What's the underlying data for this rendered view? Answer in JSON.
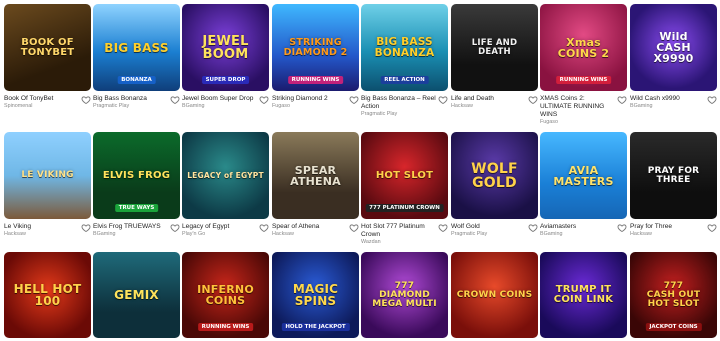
{
  "games": [
    {
      "title": "Book Of TonyBet",
      "provider": "Spinomenal",
      "art": "BOOK OF\nTONYBET",
      "art_color": "#ffd76a",
      "bg": "linear-gradient(160deg,#6b4a1e,#2b1b08 70%)",
      "art_size": "10px",
      "favorite_icon": "heart-outline-icon"
    },
    {
      "title": "Big Bass Bonanza",
      "provider": "Pragmatic Play",
      "art": "BIG BASS",
      "badge": "BONANZA",
      "art_color": "#ffcf2a",
      "badge_bg": "#1560c7",
      "bg": "linear-gradient(180deg,#8fd3ff,#1b7fd1 55%,#0f3e7a)",
      "art_size": "12px",
      "favorite_icon": "heart-outline-icon"
    },
    {
      "title": "Jewel Boom Super Drop",
      "provider": "BGaming",
      "art": "JEWEL\nBOOM",
      "badge": "SUPER DROP",
      "art_color": "#ffe35c",
      "badge_bg": "#2a2ab8",
      "bg": "radial-gradient(circle at 50% 40%,#7b3fd9,#2a0f63 75%)",
      "art_size": "13px",
      "favorite_icon": "heart-outline-icon"
    },
    {
      "title": "Striking Diamond 2",
      "provider": "Fugaso",
      "art": "STRIKING\nDIAMOND 2",
      "badge": "RUNNING WINS",
      "art_color": "#ff9a1a",
      "badge_bg": "#c2227a",
      "bg": "linear-gradient(180deg,#3fb8ff,#2357c9 60%,#1b1b6e)",
      "art_size": "9.5px",
      "favorite_icon": "heart-outline-icon"
    },
    {
      "title": "Big Bass Bonanza – Reel Action",
      "provider": "Pragmatic Play",
      "art": "BIG BASS\nBONANZA",
      "badge": "REEL ACTION",
      "art_color": "#ffcf2a",
      "badge_bg": "#1b3f9c",
      "bg": "linear-gradient(180deg,#6fd0e8,#1a8fb3 55%,#0c4f6e)",
      "art_size": "10.5px",
      "favorite_icon": "heart-outline-icon"
    },
    {
      "title": "Life and Death",
      "provider": "Hacksaw",
      "art": "LIFE AND DEATH",
      "art_color": "#f2f2f2",
      "bg": "linear-gradient(180deg,#3a3a3a,#111 70%)",
      "art_size": "8.5px",
      "favorite_icon": "heart-outline-icon"
    },
    {
      "title": "XMAS Coins 2: ULTIMATE RUNNING WINS",
      "provider": "Fugaso",
      "art": "Xmas\nCOINS 2",
      "badge": "RUNNING WINS",
      "art_color": "#ffd84a",
      "badge_bg": "#d21f3c",
      "bg": "radial-gradient(circle at 50% 35%,#e24a84,#8a1240 75%)",
      "art_size": "11px",
      "favorite_icon": "heart-outline-icon"
    },
    {
      "title": "Wild Cash x9990",
      "provider": "BGaming",
      "art": "Wild\nCASH\nX9990",
      "art_color": "#ffffff",
      "bg": "radial-gradient(circle at 50% 45%,#8a4bf0,#2b1575 70%)",
      "art_size": "11px",
      "favorite_icon": "heart-outline-icon"
    },
    {
      "title": "Le Viking",
      "provider": "Hacksaw",
      "art": "LE VIKING",
      "art_color": "#ffe28a",
      "bg": "linear-gradient(180deg,#8fd0ff,#6fb7e6 50%,#7c5a3a)",
      "art_size": "9px",
      "favorite_icon": "heart-outline-icon"
    },
    {
      "title": "Elvis Frog TRUEWAYS",
      "provider": "BGaming",
      "art": "ELVIS FROG",
      "badge": "TRUE WAYS",
      "art_color": "#ffe35c",
      "badge_bg": "#1aa33a",
      "bg": "linear-gradient(180deg,#0b6b2b,#0a3b1a 70%)",
      "art_size": "10px",
      "favorite_icon": "heart-outline-icon"
    },
    {
      "title": "Legacy of Egypt",
      "provider": "Play'n Go",
      "art": "LEGACY of EGYPT",
      "art_color": "#ffe4a0",
      "bg": "radial-gradient(circle at 50% 40%,#2a8a8a,#0d3a46 75%)",
      "art_size": "7.5px",
      "favorite_icon": "heart-outline-icon"
    },
    {
      "title": "Spear of Athena",
      "provider": "Hacksaw",
      "art": "SPEAR\nATHENA",
      "art_color": "#e8e2d0",
      "bg": "linear-gradient(180deg,#8a7a5a,#3a2e22 70%)",
      "art_size": "11px",
      "favorite_icon": "heart-outline-icon"
    },
    {
      "title": "Hot Slot 777 Platinum Crown",
      "provider": "Wazdan",
      "art": "HOT SLOT",
      "badge": "777 PLATINUM CROWN",
      "art_color": "#ffd24a",
      "badge_bg": "#222",
      "bg": "radial-gradient(circle at 50% 40%,#d8262b,#5a0a10 75%)",
      "art_size": "10px",
      "favorite_icon": "heart-outline-icon"
    },
    {
      "title": "Wolf Gold",
      "provider": "Pragmatic Play",
      "art": "WOLF\nGOLD",
      "art_color": "#ffd24a",
      "bg": "radial-gradient(circle at 50% 35%,#5a3aa8,#1a1046 75%)",
      "art_size": "14px",
      "favorite_icon": "heart-outline-icon"
    },
    {
      "title": "Aviamasters",
      "provider": "BGaming",
      "art": "AVIA\nMASTERS",
      "art_color": "#ffe26a",
      "bg": "linear-gradient(180deg,#47b8ff,#1a7fd6 60%,#1666b5)",
      "art_size": "11px",
      "favorite_icon": "heart-outline-icon"
    },
    {
      "title": "Pray for Three",
      "provider": "Hacksaw",
      "art": "PRAY FOR\nTHREE",
      "art_color": "#ffffff",
      "bg": "linear-gradient(180deg,#2a2a2a,#0e0e0e 70%)",
      "art_size": "9px",
      "favorite_icon": "heart-outline-icon"
    },
    {
      "art": "HELL HOT\n100",
      "art_color": "#ffd24a",
      "bg": "radial-gradient(circle at 50% 45%,#e43a1a,#6b0a06 75%)",
      "art_size": "12px"
    },
    {
      "art": "GEMIX",
      "art_color": "#ffe35c",
      "bg": "linear-gradient(180deg,#1f6a7a,#0d2f3a 70%)",
      "art_size": "12px"
    },
    {
      "art": "INFERNO\nCOINS",
      "badge": "RUNNING WINS",
      "art_color": "#ffc23a",
      "badge_bg": "#b81a1a",
      "bg": "radial-gradient(circle at 50% 40%,#c7261a,#4a0806 75%)",
      "art_size": "11px"
    },
    {
      "art": "MAGIC\nSPINS",
      "badge": "HOLD THE JACKPOT",
      "art_color": "#ffd84a",
      "badge_bg": "#1a2f9c",
      "bg": "radial-gradient(circle at 50% 40%,#2a5bd6,#0d1a5a 75%)",
      "art_size": "12px"
    },
    {
      "art": "777\nDIAMOND\nMEGA MULTI",
      "art_color": "#ffe35c",
      "bg": "radial-gradient(circle at 50% 40%,#b04ad6,#3a0a5a 75%)",
      "art_size": "9px"
    },
    {
      "art": "CROWN COINS",
      "art_color": "#ffd24a",
      "bg": "radial-gradient(circle at 50% 40%,#e84a2a,#7a0f0a 75%)",
      "art_size": "9px"
    },
    {
      "art": "TRUMP IT\nCOIN LINK",
      "art_color": "#ffe35c",
      "bg": "radial-gradient(circle at 50% 40%,#6a2ad6,#1a0a5a 75%)",
      "art_size": "10px"
    },
    {
      "art": "777\nCASH OUT\nHOT SLOT",
      "badge": "JACKPOT COINS",
      "art_color": "#ffd24a",
      "badge_bg": "#8a0f0f",
      "bg": "radial-gradient(circle at 50% 40%,#c21f1f,#3a0606 75%)",
      "art_size": "9px"
    }
  ]
}
